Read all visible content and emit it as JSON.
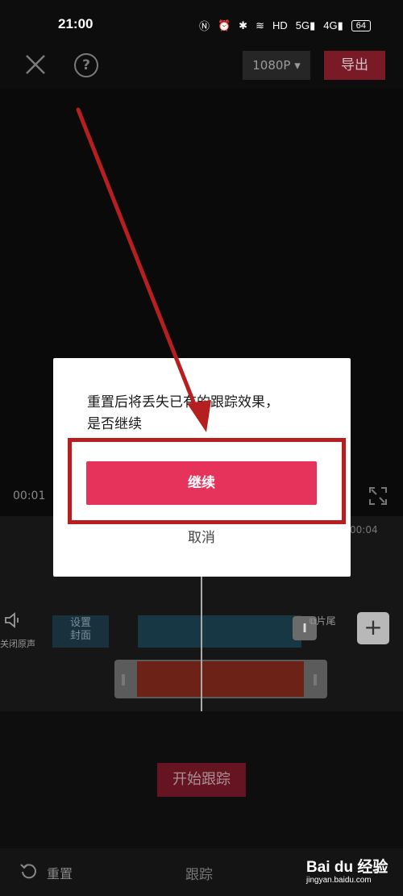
{
  "status_bar": {
    "time": "21:00",
    "icons": [
      "nfc-icon",
      "alarm-icon",
      "bluetooth-icon",
      "wifi-icon",
      "hd-icon",
      "signal-5g-icon",
      "signal-4g-icon"
    ],
    "battery": "64"
  },
  "top_bar": {
    "help_label": "?",
    "resolution": "1080P ▾",
    "export_label": "导出"
  },
  "player": {
    "time_current": "00:01"
  },
  "timeline": {
    "ruler_right": "00:04",
    "mute_label": "关闭原声",
    "cover_line1": "设置",
    "cover_line2": "封面",
    "clip_handle": "I",
    "tail_label": "片尾",
    "add_label": "+"
  },
  "bottom": {
    "track_button": "开始跟踪",
    "reset_label": "重置",
    "track_tab": "跟踪",
    "confirm": "✓"
  },
  "dialog": {
    "message_line1": "重置后将丢失已有的跟踪效果，",
    "message_line2": "是否继续",
    "continue_label": "继续",
    "cancel_label": "取消"
  },
  "colors": {
    "accent": "#e6335c",
    "annotation": "#b51f1f"
  },
  "watermark": {
    "brand": "Bai du 经验",
    "url": "jingyan.baidu.com"
  }
}
